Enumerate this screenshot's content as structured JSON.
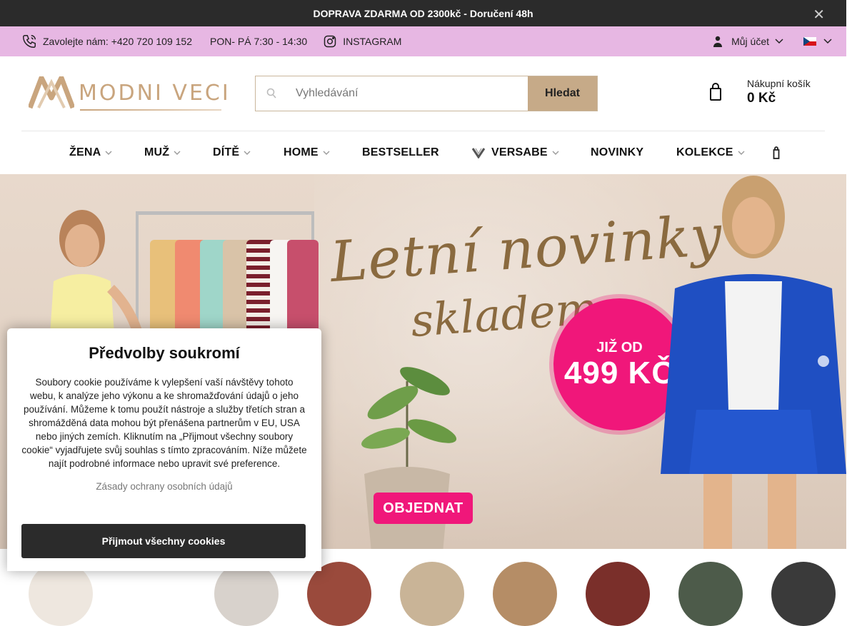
{
  "promo": {
    "text": "DOPRAVA ZDARMA OD 2300kč - Doručení 48h",
    "close": "✕"
  },
  "topbar": {
    "phone": "Zavolejte nám: +420 720 109 152",
    "hours": "PON- PÁ 7:30 - 14:30",
    "instagram": "INSTAGRAM",
    "account": "Můj účet",
    "language_flag": "cz-flag-icon"
  },
  "header": {
    "logo_text": "MODNI VECI",
    "search": {
      "placeholder": "Vyhledávání",
      "button": "Hledat"
    },
    "cart": {
      "label": "Nákupní košík",
      "price": "0 Kč"
    }
  },
  "nav": {
    "items": [
      {
        "label": "ŽENA",
        "dropdown": true
      },
      {
        "label": "MUŽ",
        "dropdown": true
      },
      {
        "label": "DÍTĚ",
        "dropdown": true
      },
      {
        "label": "HOME",
        "dropdown": true
      },
      {
        "label": "BESTSELLER",
        "dropdown": false
      },
      {
        "label": "VERSABE",
        "dropdown": true
      },
      {
        "label": "NOVINKY",
        "dropdown": false
      },
      {
        "label": "KOLEKCE",
        "dropdown": true
      }
    ]
  },
  "hero": {
    "headline_line1": "Letní novinky",
    "headline_line2": "skladem",
    "badge_small": "JIŽ OD",
    "badge_big": "499 KČ",
    "cta": "OBJEDNAT"
  },
  "cookie": {
    "title": "Předvolby soukromí",
    "body": "Soubory cookie používáme k vylepšení vaší návštěvy tohoto webu, k analýze jeho výkonu a ke shromažďování údajů o jeho používání. Můžeme k tomu použít nástroje a služby třetích stran a shromážděná data mohou být přenášena partnerům v EU, USA nebo jiných zemích. Kliknutím na „Přijmout všechny soubory cookie“ vyjadřujete svůj souhlas s tímto zpracováním. Níže můžete najít podrobné informace nebo upravit své preference.",
    "privacy_link": "Zásady ochrany osobních údajů",
    "accept": "Přijmout všechny cookies"
  },
  "colors": {
    "promo_bg": "#2b2b2b",
    "topbar_bg": "#e7b7e3",
    "brand_gold": "#c9a57e",
    "search_button": "#c6aa88",
    "accent_pink": "#f0177a"
  }
}
